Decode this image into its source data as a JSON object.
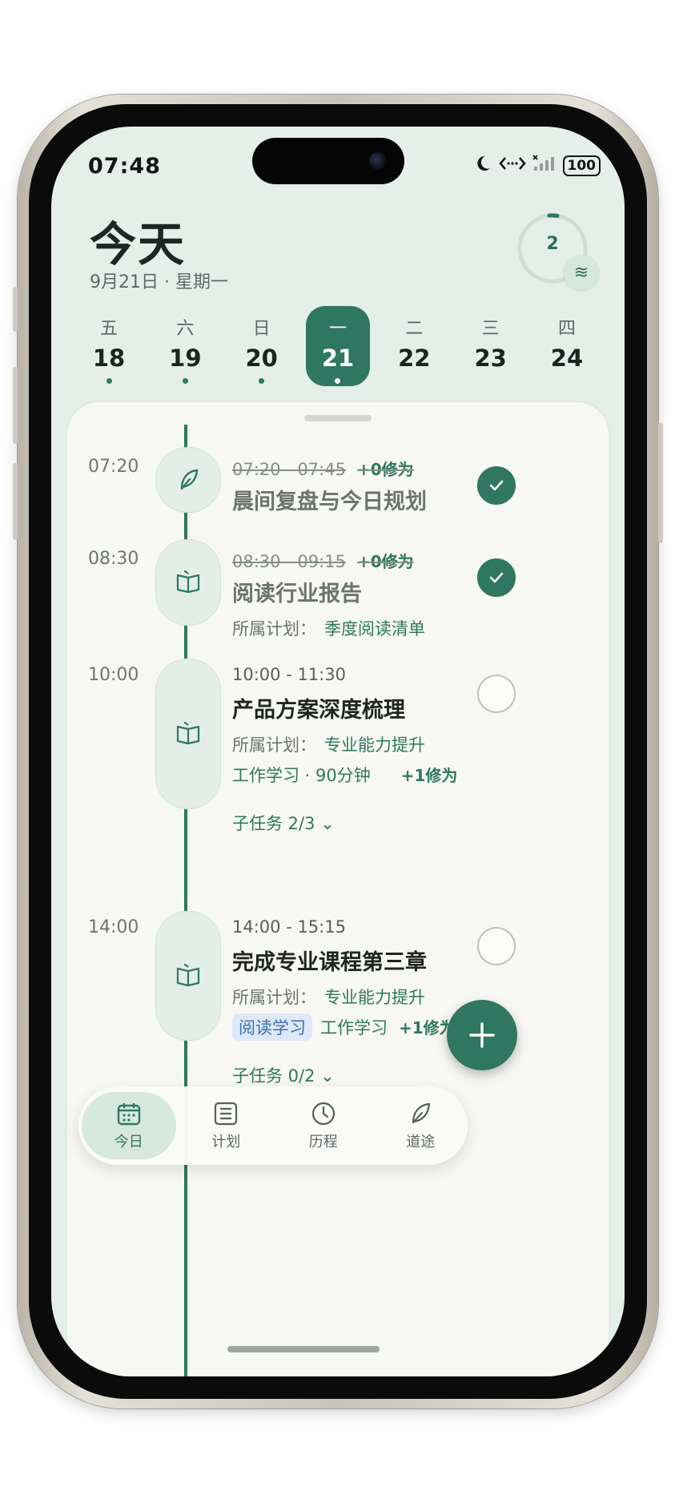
{
  "status_bar": {
    "time": "07:48",
    "battery": "100"
  },
  "header": {
    "title": "今天",
    "subtitle": "9月21日 · 星期一",
    "ring_count": "2"
  },
  "week": [
    {
      "weekday": "五",
      "day": "18",
      "has_dot": true
    },
    {
      "weekday": "六",
      "day": "19",
      "has_dot": true
    },
    {
      "weekday": "日",
      "day": "20",
      "has_dot": true
    },
    {
      "weekday": "一",
      "day": "21",
      "has_dot": true,
      "selected": true
    },
    {
      "weekday": "二",
      "day": "22",
      "has_dot": false
    },
    {
      "weekday": "三",
      "day": "23",
      "has_dot": false
    },
    {
      "weekday": "四",
      "day": "24",
      "has_dot": false
    }
  ],
  "plan_label": "所属计划：",
  "tasks": [
    {
      "time": "07:20",
      "range": "07:20 - 07:45",
      "xp": "+0修为",
      "title": "晨间复盘与今日规划",
      "done": true,
      "icon": "leaf-icon"
    },
    {
      "time": "08:30",
      "range": "08:30 - 09:15",
      "xp": "+0修为",
      "title": "阅读行业报告",
      "plan": "季度阅读清单",
      "done": true,
      "icon": "book-icon"
    },
    {
      "time": "10:00",
      "range": "10:00 - 11:30",
      "title": "产品方案深度梳理",
      "plan": "专业能力提升",
      "meta": "工作学习 · 90分钟",
      "xp": "+1修为",
      "subtasks": "子任务 2/3",
      "done": false,
      "icon": "book-icon"
    },
    {
      "time": "14:00",
      "range": "14:00 - 15:15",
      "title": "完成专业课程第三章",
      "plan": "专业能力提升",
      "tag": "阅读学习",
      "meta": "工作学习",
      "xp": "+1修为",
      "subtasks": "子任务 0/2",
      "done": false,
      "icon": "book-icon"
    }
  ],
  "tabs": [
    {
      "label": "今日",
      "icon": "calendar-icon",
      "active": true
    },
    {
      "label": "计划",
      "icon": "list-icon"
    },
    {
      "label": "历程",
      "icon": "clock-icon"
    },
    {
      "label": "道途",
      "icon": "leaf-icon"
    }
  ],
  "colors": {
    "accent": "#2f7760",
    "background": "#e4efea",
    "sheet": "#f7f7f4"
  }
}
